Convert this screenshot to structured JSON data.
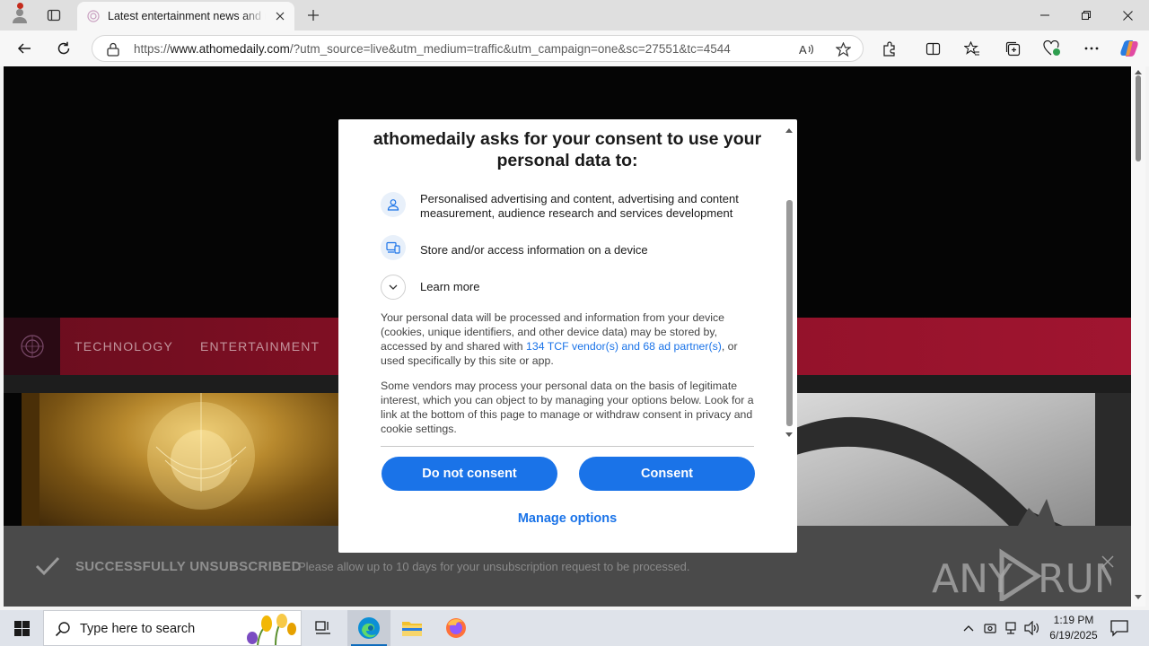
{
  "browser": {
    "tab_title": "Latest entertainment news and re",
    "url_prefix": "https://",
    "url_domain": "www.athomedaily.com",
    "url_rest": "/?utm_source=live&utm_medium=traffic&utm_campaign=one&sc=27551&tc=4544",
    "accent_color": "#0f6cbd"
  },
  "site": {
    "nav": [
      "TECHNOLOGY",
      "ENTERTAINMENT"
    ],
    "nav_gradient": [
      "#6a0d1e",
      "#a01530"
    ]
  },
  "consent": {
    "heading": "athomedaily asks for your consent to use your personal data to:",
    "purposes": [
      {
        "icon": "person-icon",
        "text": "Personalised advertising and content, advertising and content measurement, audience research and services development"
      },
      {
        "icon": "device-icon",
        "text": "Store and/or access information on a device"
      }
    ],
    "learn_more": "Learn more",
    "para1_before": "Your personal data will be processed and information from your device (cookies, unique identifiers, and other device data) may be stored by, accessed by and shared with ",
    "para1_link": "134 TCF vendor(s) and 68 ad partner(s)",
    "para1_after": ", or used specifically by this site or app.",
    "para2": "Some vendors may process your personal data on the basis of legitimate interest, which you can object to by managing your options below. Look for a link at the bottom of this page to manage or withdraw consent in privacy and cookie settings.",
    "do_not_consent": "Do not consent",
    "consent": "Consent",
    "manage_options": "Manage options",
    "button_color": "#1a73e8"
  },
  "unsubscribe": {
    "title": "SUCCESSFULLY UNSUBSCRIBED",
    "message": "Please allow up to 10 days for your unsubscription request to be processed."
  },
  "watermark": "ANY RUN",
  "taskbar": {
    "search_placeholder": "Type here to search",
    "time": "1:19 PM",
    "date": "6/19/2025"
  }
}
